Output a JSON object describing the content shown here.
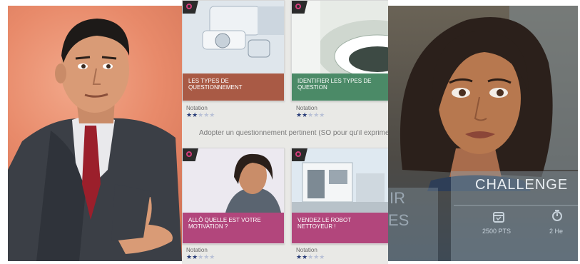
{
  "left_panel": {
    "character": "businessman"
  },
  "catalog": {
    "section_title": "Adopter un questionnement pertinent (SO pour qu'il exprime ses motivations",
    "cards": [
      {
        "title": "LES TYPES DE QUESTIONNEMENT",
        "rating_label": "Notation",
        "stars": 2,
        "ribbon_color": "#a95a45"
      },
      {
        "title": "IDENTIFIER LES TYPES DE QUESTION",
        "rating_label": "Notation",
        "stars": 2,
        "ribbon_color": "#4b8a67"
      },
      {
        "title": "ALLÔ QUELLE EST VOTRE MOTIVATION ?",
        "rating_label": "Notation",
        "stars": 2,
        "ribbon_color": "#b2467c"
      },
      {
        "title": "VENDEZ LE ROBOT NETTOYEUR !",
        "rating_label": "Notation",
        "stars": 2,
        "ribbon_color": "#b2467c"
      }
    ],
    "star_glyphs": {
      "filled": "★★",
      "empty": "★★★"
    }
  },
  "right_panel": {
    "challenge_title": "CHALLENGE",
    "points": "2500 PTS",
    "duration": "2 He",
    "partial_left_top": "IR",
    "partial_left_bottom": "ES"
  }
}
